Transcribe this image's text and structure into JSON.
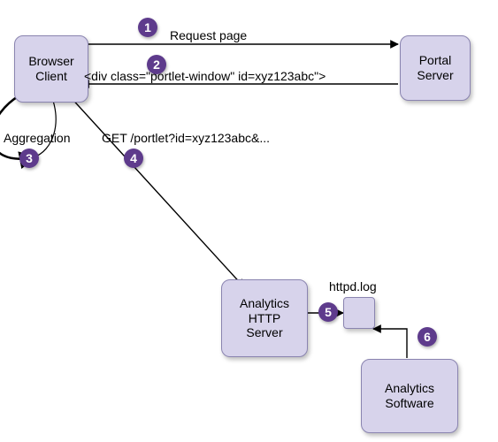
{
  "nodes": {
    "browser_client": "Browser\nClient",
    "portal_server": "Portal\nServer",
    "analytics_http_server": "Analytics\nHTTP\nServer",
    "analytics_software": "Analytics\nSoftware",
    "httpd_log": "httpd.log"
  },
  "edges": {
    "request_page": "Request page",
    "div_response": "<div class=\"portlet-window\" id=xyz123abc\">",
    "aggregation": "Aggregation",
    "get_portlet": "GET /portlet?id=xyz123abc&..."
  },
  "badges": {
    "b1": "1",
    "b2": "2",
    "b3": "3",
    "b4": "4",
    "b5": "5",
    "b6": "6"
  },
  "chart_data": {
    "type": "table",
    "title": "Portal analytics request flow",
    "nodes": [
      {
        "id": "browser_client",
        "label": "Browser Client"
      },
      {
        "id": "portal_server",
        "label": "Portal Server"
      },
      {
        "id": "analytics_http_server",
        "label": "Analytics HTTP Server"
      },
      {
        "id": "httpd_log",
        "label": "httpd.log"
      },
      {
        "id": "analytics_software",
        "label": "Analytics Software"
      }
    ],
    "steps": [
      {
        "step": 1,
        "from": "browser_client",
        "to": "portal_server",
        "label": "Request page"
      },
      {
        "step": 2,
        "from": "portal_server",
        "to": "browser_client",
        "label": "<div class=\"portlet-window\" id=xyz123abc\">"
      },
      {
        "step": 3,
        "from": "browser_client",
        "to": "browser_client",
        "label": "Aggregation"
      },
      {
        "step": 4,
        "from": "browser_client",
        "to": "analytics_http_server",
        "label": "GET /portlet?id=xyz123abc&..."
      },
      {
        "step": 5,
        "from": "analytics_http_server",
        "to": "httpd_log",
        "label": ""
      },
      {
        "step": 6,
        "from": "analytics_software",
        "to": "httpd_log",
        "label": ""
      }
    ]
  }
}
